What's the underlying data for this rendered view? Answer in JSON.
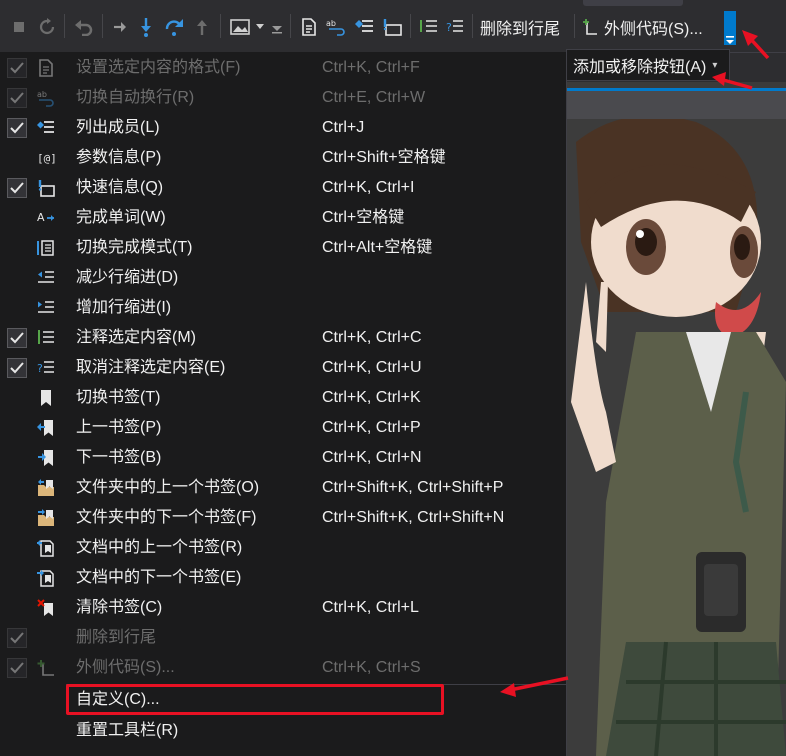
{
  "toolbar": {
    "tab_label": "",
    "icons": [
      "stop-icon",
      "refresh-icon",
      "undo-icon",
      "step-over-icon",
      "step-into-icon",
      "step-over-loop-icon",
      "step-out-icon",
      "image-icon",
      "dropdown-caret-icon",
      "format-document-icon",
      "word-wrap-icon",
      "list-members-icon",
      "quick-info-icon",
      "comment-icon",
      "uncomment-icon"
    ],
    "delete_to_eol_label": "删除到行尾",
    "surround_with_label": "外侧代码(S)...",
    "add_remove_buttons_label": "添加或移除按钮(A)"
  },
  "menu": {
    "items": [
      {
        "label": "设置选定内容的格式(F)",
        "shortcut": "Ctrl+K, Ctrl+F",
        "checked": true,
        "disabled": true,
        "icon": "format-selection-icon"
      },
      {
        "label": "切换自动换行(R)",
        "shortcut": "Ctrl+E, Ctrl+W",
        "checked": true,
        "disabled": true,
        "icon": "word-wrap-icon"
      },
      {
        "label": "列出成员(L)",
        "shortcut": "Ctrl+J",
        "checked": true,
        "disabled": false,
        "icon": "list-members-icon"
      },
      {
        "label": "参数信息(P)",
        "shortcut": "Ctrl+Shift+空格键",
        "checked": false,
        "disabled": false,
        "icon": "parameter-info-icon"
      },
      {
        "label": "快速信息(Q)",
        "shortcut": "Ctrl+K, Ctrl+I",
        "checked": true,
        "disabled": false,
        "icon": "quick-info-icon"
      },
      {
        "label": "完成单词(W)",
        "shortcut": "Ctrl+空格键",
        "checked": false,
        "disabled": false,
        "icon": "complete-word-icon"
      },
      {
        "label": "切换完成模式(T)",
        "shortcut": "Ctrl+Alt+空格键",
        "checked": false,
        "disabled": false,
        "icon": "completion-mode-icon"
      },
      {
        "label": "减少行缩进(D)",
        "shortcut": "",
        "checked": false,
        "disabled": false,
        "icon": "decrease-indent-icon"
      },
      {
        "label": "增加行缩进(I)",
        "shortcut": "",
        "checked": false,
        "disabled": false,
        "icon": "increase-indent-icon"
      },
      {
        "label": "注释选定内容(M)",
        "shortcut": "Ctrl+K, Ctrl+C",
        "checked": true,
        "disabled": false,
        "icon": "comment-icon"
      },
      {
        "label": "取消注释选定内容(E)",
        "shortcut": "Ctrl+K, Ctrl+U",
        "checked": true,
        "disabled": false,
        "icon": "uncomment-icon"
      },
      {
        "label": "切换书签(T)",
        "shortcut": "Ctrl+K, Ctrl+K",
        "checked": false,
        "disabled": false,
        "icon": "bookmark-icon"
      },
      {
        "label": "上一书签(P)",
        "shortcut": "Ctrl+K, Ctrl+P",
        "checked": false,
        "disabled": false,
        "icon": "previous-bookmark-icon"
      },
      {
        "label": "下一书签(B)",
        "shortcut": "Ctrl+K, Ctrl+N",
        "checked": false,
        "disabled": false,
        "icon": "next-bookmark-icon"
      },
      {
        "label": "文件夹中的上一个书签(O)",
        "shortcut": "Ctrl+Shift+K, Ctrl+Shift+P",
        "checked": false,
        "disabled": false,
        "icon": "folder-previous-bookmark-icon"
      },
      {
        "label": "文件夹中的下一个书签(F)",
        "shortcut": "Ctrl+Shift+K, Ctrl+Shift+N",
        "checked": false,
        "disabled": false,
        "icon": "folder-next-bookmark-icon"
      },
      {
        "label": "文档中的上一个书签(R)",
        "shortcut": "",
        "checked": false,
        "disabled": false,
        "icon": "document-previous-bookmark-icon"
      },
      {
        "label": "文档中的下一个书签(E)",
        "shortcut": "",
        "checked": false,
        "disabled": false,
        "icon": "document-next-bookmark-icon"
      },
      {
        "label": "清除书签(C)",
        "shortcut": "Ctrl+K, Ctrl+L",
        "checked": false,
        "disabled": false,
        "icon": "clear-bookmarks-icon"
      },
      {
        "label": "删除到行尾",
        "shortcut": "",
        "checked": true,
        "disabled": true,
        "icon": ""
      },
      {
        "label": "外侧代码(S)...",
        "shortcut": "Ctrl+K, Ctrl+S",
        "checked": true,
        "disabled": true,
        "icon": "surround-with-icon"
      }
    ],
    "customize_label": "自定义(C)...",
    "reset_toolbar_label": "重置工具栏(R)"
  },
  "colors": {
    "accent": "#007acc",
    "annotation_red": "#e81123",
    "menu_bg": "#1b1b1c",
    "toolbar_bg": "#2d2d30"
  }
}
